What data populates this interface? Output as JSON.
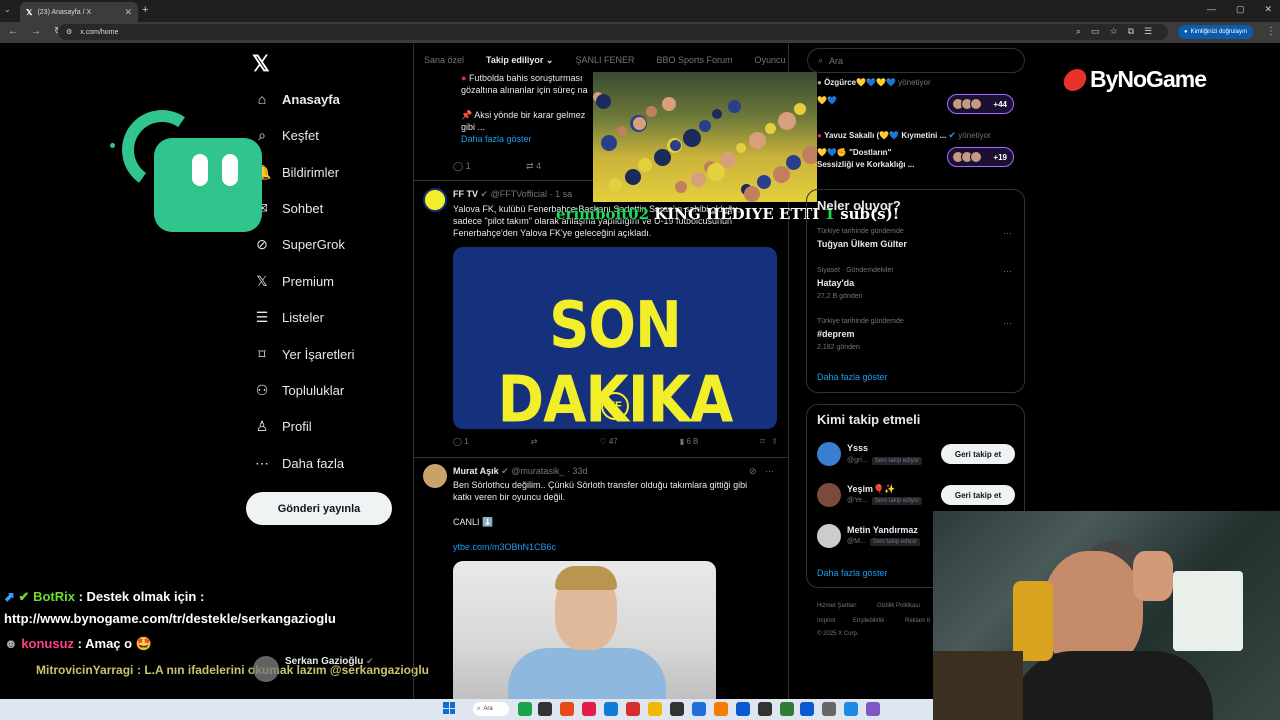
{
  "browser": {
    "tab_title": "(23) Anasayfa / X",
    "url": "x.com/home",
    "verify_label": "Kimliğinizi doğrulayın"
  },
  "nav": {
    "items": [
      {
        "label": "Anasayfa",
        "icon": "home-icon"
      },
      {
        "label": "Keşfet",
        "icon": "search-icon"
      },
      {
        "label": "Bildirimler",
        "icon": "bell-icon"
      },
      {
        "label": "Sohbet",
        "icon": "chat-icon"
      },
      {
        "label": "SuperGrok",
        "icon": "grok-icon"
      },
      {
        "label": "Premium",
        "icon": "x-icon"
      },
      {
        "label": "Listeler",
        "icon": "list-icon"
      },
      {
        "label": "Yer İşaretleri",
        "icon": "bookmark-icon"
      },
      {
        "label": "Topluluklar",
        "icon": "people-icon"
      },
      {
        "label": "Profil",
        "icon": "person-icon"
      },
      {
        "label": "Daha fazla",
        "icon": "more-icon"
      }
    ],
    "post_button": "Gönderi yayınla"
  },
  "feed_tabs": [
    "Sana özel",
    "Takip ediliyor",
    "ŞANLI FENER",
    "BBO Sports Forum",
    "Oyuncu"
  ],
  "tweets": {
    "partial": {
      "line1": "Futbolda bahis soruşturması",
      "line2": "gözaltına alınanlar için süreç na",
      "line3": "📌 Aksi yönde bir karar gelmez",
      "line4": "gibi ...",
      "show_more": "Daha fazla göster",
      "replies": "1",
      "retweets": "4"
    },
    "fftv": {
      "name": "FF TV",
      "handle": "@FFTVofficial",
      "time": "· 1 sa",
      "text1": "Yalova FK, kulübü Fenerbahçe Başkanı Sadettin Saran'ın sahibi olduğu,",
      "text2": "sadece \"pilot takım\" olarak anlaşma yapıldığını ve U-19 futbolcusunun",
      "text3": "Fenerbahçe'den Yalova FK'ye geleceğini açıkladı.",
      "image_text": "SON DAKIKA",
      "badge": "FF",
      "replies": "1",
      "likes": "47",
      "views": "6 B"
    },
    "murat": {
      "name": "Murat Aşık",
      "handle": "@muratasik_",
      "time": "· 33d",
      "text1": "Ben Sörlothcu değilim.. Çünkü Sörloth transfer olduğu takımlara gittiği gibi",
      "text2": "katkı veren bir oyuncu değil.",
      "text3": "CANLI ⬇️",
      "link": "ytbe.com/m3OBhN1CB6c"
    },
    "bottom_author": "Serkan Gazioğlu"
  },
  "stream_alert": {
    "name": "erimbolt02",
    "action": "KING HEDIYE ETTI",
    "count": "1",
    "suffix": "sub(s)!"
  },
  "chat": [
    {
      "user": "BotRix",
      "text": ": Destek olmak için :"
    },
    {
      "user": "",
      "text": "http://www.bynogame.com/tr/destekle/serkangazioglu"
    },
    {
      "user": "konusuz",
      "text": ": Amaç o 🤩"
    },
    {
      "user": "MitrovicinYarragi",
      "text": ": L.A nın ifadelerini okumak lazım @serkangazioglu"
    }
  ],
  "right": {
    "search_placeholder": "Ara",
    "spaces": [
      {
        "line1": "Özgürce💛💙💛💙",
        "role": "yönetiyor",
        "line2": "💛💙",
        "count": "+44"
      },
      {
        "line1": "Yavuz Sakallı (💛💙 Kıymetini ...",
        "role": "yönetiyor",
        "line2": "💛💙✊ \"Dostların\"",
        "line3": "Sessizliği ve Korkaklığı ...",
        "count": "+19"
      }
    ],
    "trends_title": "Neler oluyor?",
    "trends": [
      {
        "meta": "Türkiye tarihinde gündemde",
        "name": "Tuğyan Ülkem Gülter",
        "count": ""
      },
      {
        "meta": "Siyaset · Gündemdekiler",
        "name": "Hatay'da",
        "count": "27,2 B gönderi"
      },
      {
        "meta": "Türkiye tarihinde gündemde",
        "name": "#deprem",
        "count": "2.182 gönderi"
      }
    ],
    "trends_more": "Daha fazla göster",
    "who_title": "Kimi takip etmeli",
    "who": [
      {
        "name": "Ysss",
        "handle": "@gri...",
        "tag": "Seni takip ediyor",
        "button": "Geri takip et"
      },
      {
        "name": "Yeşim🎈✨",
        "handle": "@Ye...",
        "tag": "Seni takip ediyor",
        "button": "Geri takip et"
      },
      {
        "name": "Metin Yandırmaz",
        "handle": "@M...",
        "tag": "Seni takip ediyor",
        "button": ""
      }
    ],
    "who_more": "Daha fazla göster",
    "footer": [
      "Hizmet Şartları",
      "Gizlilik Politikası",
      "Imprint",
      "Erişilebilirlik",
      "Reklam b",
      "© 2025 X Corp."
    ]
  },
  "brand": {
    "logo_text": "ByNoGame"
  },
  "taskbar": {
    "search": "Ara"
  }
}
